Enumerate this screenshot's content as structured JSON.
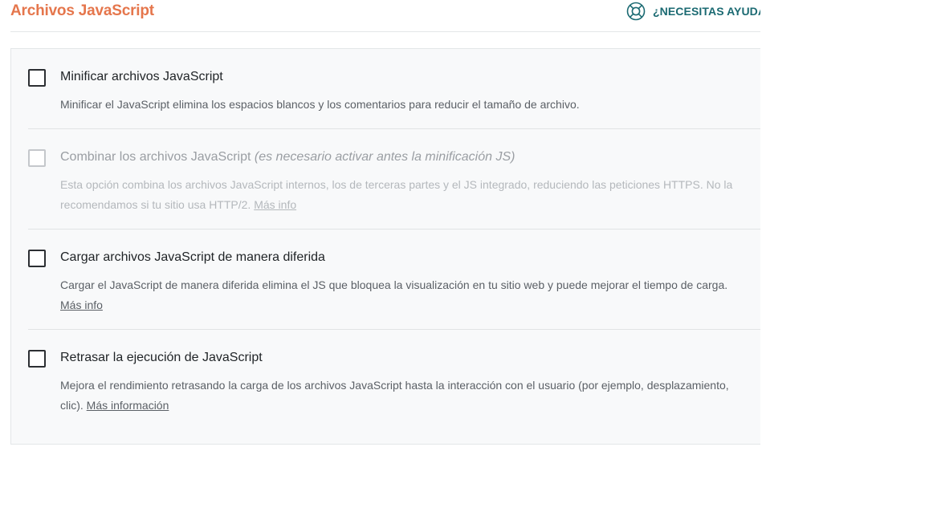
{
  "header": {
    "title": "Archivos JavaScript",
    "help_label": "¿NECESITAS AYUDA?"
  },
  "colors": {
    "title_accent": "#e5764c",
    "help_accent": "#1b6a72"
  },
  "options": [
    {
      "title": "Minificar archivos JavaScript",
      "note": "",
      "description": "Minificar el JavaScript elimina los espacios blancos y los comentarios para reducir el tamaño de archivo.",
      "link": "",
      "checked": false,
      "enabled": true
    },
    {
      "title": "Combinar los archivos JavaScript",
      "note": "(es necesario activar antes la minificación JS)",
      "description": "Esta opción combina los archivos JavaScript internos, los de terceras partes y el JS integrado, reduciendo las peticiones HTTPS. No la recomendamos si tu sitio usa HTTP/2.",
      "link": "Más info",
      "checked": false,
      "enabled": false
    },
    {
      "title": "Cargar archivos JavaScript de manera diferida",
      "note": "",
      "description": "Cargar el JavaScript de manera diferida elimina el JS que bloquea la visualización en tu sitio web y puede mejorar el tiempo de carga.",
      "link": "Más info",
      "checked": false,
      "enabled": true
    },
    {
      "title": "Retrasar la ejecución de JavaScript",
      "note": "",
      "description": "Mejora el rendimiento retrasando la carga de los archivos JavaScript hasta la interacción con el usuario (por ejemplo, desplazamiento, clic).",
      "link": "Más información",
      "checked": false,
      "enabled": true
    }
  ]
}
